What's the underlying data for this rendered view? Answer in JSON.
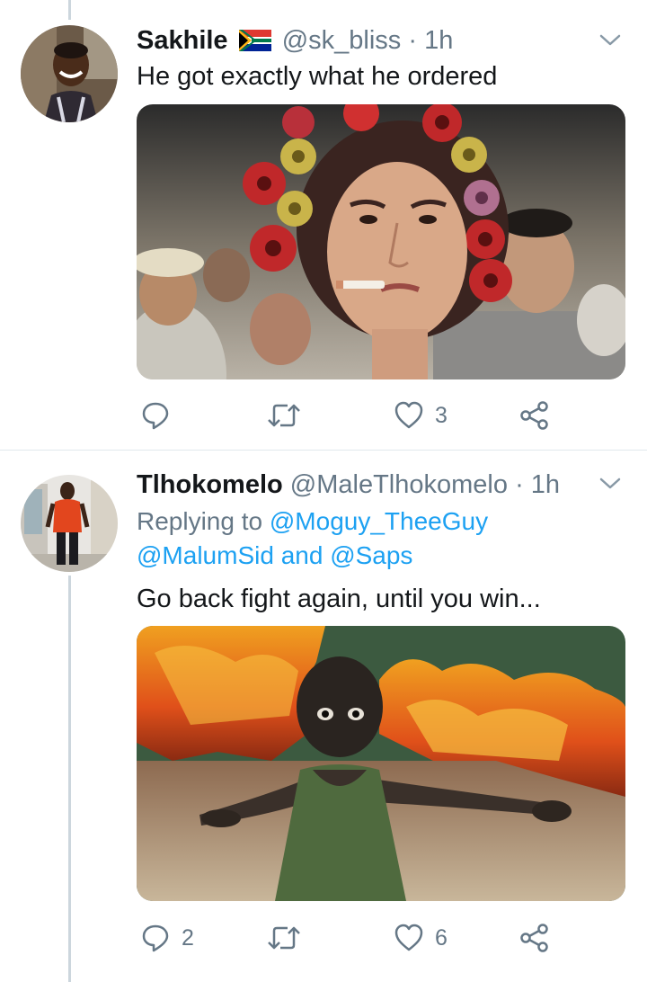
{
  "tweets": [
    {
      "display_name": "Sakhile",
      "flag": "south-africa-flag",
      "handle": "@sk_bliss",
      "separator": "·",
      "time": "1h",
      "text": "He got exactly what he ordered",
      "replies": "",
      "retweets": "",
      "likes": "3"
    },
    {
      "display_name": "Tlhokomelo",
      "handle": "@MaleTlhokomelo",
      "separator": "·",
      "time": "1h",
      "replying_prefix": "Replying to",
      "mention_1": "@Moguy_TheeGuy",
      "mention_2": "@MalumSid",
      "conjunction": "and",
      "mention_3": "@Saps",
      "text": "Go back fight again, until you win...",
      "replies": "2",
      "retweets": "",
      "likes": "6"
    }
  ],
  "colors": {
    "text": "#14171a",
    "secondary": "#657786",
    "link": "#1da1f2",
    "thread_line": "#ccd6dd",
    "divider": "#e1e8ed"
  },
  "icons": [
    "reply-icon",
    "retweet-icon",
    "like-icon",
    "share-icon",
    "chevron-down-icon"
  ]
}
